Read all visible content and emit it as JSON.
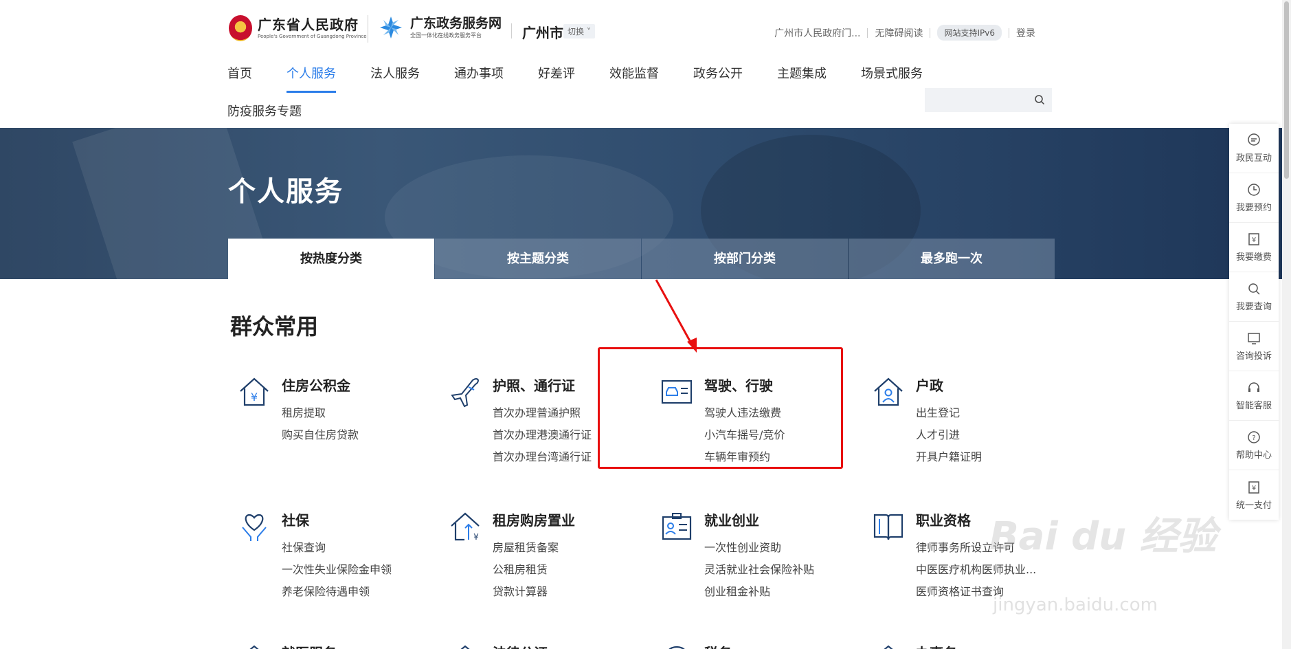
{
  "header": {
    "gov_title": "广东省人民政府",
    "gov_subtitle": "People's Government of Guangdong Province",
    "svc_title": "广东政务服务网",
    "svc_subtitle": "全国一体化在线政务服务平台",
    "city": "广州市",
    "switch_label": "切换",
    "top_links": [
      "广州市人民政府门...",
      "无障碍阅读",
      "网站支持IPv6",
      "登录"
    ]
  },
  "nav": {
    "items": [
      "首页",
      "个人服务",
      "法人服务",
      "通办事项",
      "好差评",
      "效能监督",
      "政务公开",
      "主题集成",
      "场景式服务"
    ],
    "active": "个人服务",
    "second_row": "防疫服务专题",
    "search_placeholder": ""
  },
  "banner": {
    "title": "个人服务",
    "tabs": [
      "按热度分类",
      "按主题分类",
      "按部门分类",
      "最多跑一次"
    ],
    "active_tab": "按热度分类"
  },
  "section": {
    "title": "群众常用",
    "categories": [
      {
        "name": "住房公积金",
        "items": [
          "租房提取",
          "购买自住房贷款"
        ],
        "icon": "house-yuan-icon"
      },
      {
        "name": "护照、通行证",
        "items": [
          "首次办理普通护照",
          "首次办理港澳通行证",
          "首次办理台湾通行证"
        ],
        "icon": "airplane-icon"
      },
      {
        "name": "驾驶、行驶",
        "items": [
          "驾驶人违法缴费",
          "小汽车摇号/竞价",
          "车辆年审预约"
        ],
        "icon": "car-card-icon"
      },
      {
        "name": "户政",
        "items": [
          "出生登记",
          "人才引进",
          "开具户籍证明"
        ],
        "icon": "house-person-icon"
      },
      {
        "name": "社保",
        "items": [
          "社保查询",
          "一次性失业保险金申领",
          "养老保险待遇申领"
        ],
        "icon": "heart-hand-icon"
      },
      {
        "name": "租房购房置业",
        "items": [
          "房屋租赁备案",
          "公租房租赁",
          "贷款计算器"
        ],
        "icon": "house-up-icon"
      },
      {
        "name": "就业创业",
        "items": [
          "一次性创业资助",
          "灵活就业社会保险补贴",
          "创业租金补贴"
        ],
        "icon": "id-badge-icon"
      },
      {
        "name": "职业资格",
        "items": [
          "律师事务所设立许可",
          "中医医疗机构医师执业...",
          "医师资格证书查询"
        ],
        "icon": "book-icon"
      }
    ],
    "partial_row": [
      "就医服务",
      "法律公证",
      "税务",
      "办事务"
    ]
  },
  "float_sidebar": [
    "政民互动",
    "我要预约",
    "我要缴费",
    "我要查询",
    "咨询投诉",
    "智能客服",
    "帮助中心",
    "统一支付"
  ],
  "watermark": {
    "main": "Bai du 经验",
    "sub": "jingyan.baidu.com"
  },
  "colors": {
    "accent": "#2b7de9",
    "highlight": "#e81010",
    "banner": "#2f4764"
  }
}
